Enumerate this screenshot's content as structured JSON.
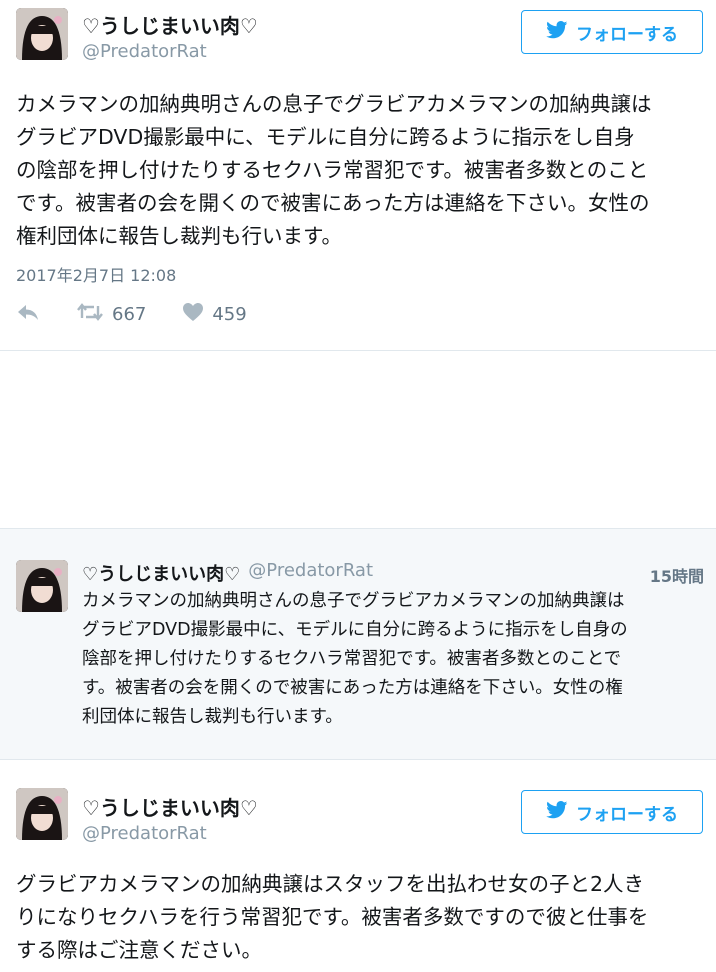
{
  "accent": "#1da1f2",
  "tweet1": {
    "name": "♡うしじまいい肉♡",
    "handle": "@PredatorRat",
    "follow_label": "フォローする",
    "text": "カメラマンの加納典明さんの息子でグラビアカメラマンの加納典譲は\nグラビアDVD撮影最中に、モデルに自分に跨るように指示をし自身\nの陰部を押し付けたりするセクハラ常習犯です。被害者多数とのこと\nです。被害者の会を開くので被害にあった方は連絡を下さい。女性の\n権利団体に報告し裁判も行います。",
    "timestamp": "2017年2月7日 12:08",
    "retweets": "667",
    "likes": "459"
  },
  "quoted": {
    "name": "♡うしじまいい肉♡",
    "handle": "@PredatorRat",
    "time": "15時間",
    "text": "カメラマンの加納典明さんの息子でグラビアカメラマンの加納典譲は\nグラビアDVD撮影最中に、モデルに自分に跨るように指示をし自身の\n陰部を押し付けたりするセクハラ常習犯です。被害者多数とのことで\nす。被害者の会を開くので被害にあった方は連絡を下さい。女性の権\n利団体に報告し裁判も行います。"
  },
  "tweet2": {
    "name": "♡うしじまいい肉♡",
    "handle": "@PredatorRat",
    "follow_label": "フォローする",
    "text": "グラビアカメラマンの加納典譲はスタッフを出払わせ女の子と2人き\nりになりセクハラを行う常習犯です。被害者多数ですので彼と仕事を\nする際はご注意ください。"
  },
  "icons": {
    "bird": "twitter-bird-icon",
    "reply": "reply-icon",
    "retweet": "retweet-icon",
    "like": "heart-icon"
  }
}
